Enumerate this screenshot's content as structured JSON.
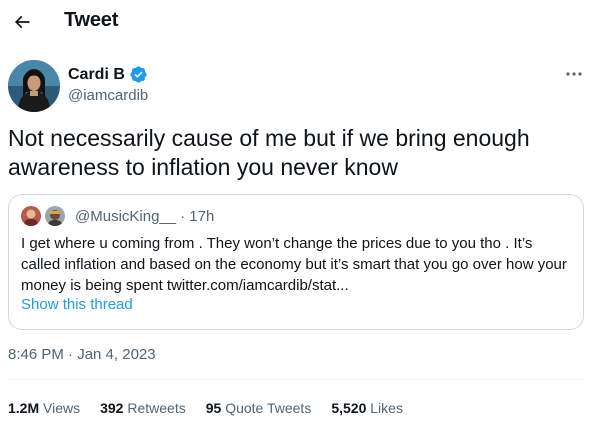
{
  "header": {
    "title": "Tweet",
    "back_icon": "arrow-left-icon"
  },
  "author": {
    "name": "Cardi B",
    "handle": "@iamcardib",
    "verified_icon": "verified-badge-icon",
    "verified_color": "#1d9bf0"
  },
  "tweet": {
    "text": "Not necessarily cause of me but if we bring enough awareness to inflation you never know",
    "timestamp": "8:46 PM · Jan 4, 2023"
  },
  "quote": {
    "handle": "@MusicKing__",
    "time": "· 17h",
    "body": "I get where u coming from . They won’t change the prices due to you tho . It’s called inflation and based on the economy but it’s smart that you go over how your money is being spent twitter.com/iamcardib/stat...",
    "show_thread": "Show this thread"
  },
  "stats": [
    {
      "num": "1.2M",
      "label": "Views"
    },
    {
      "num": "392",
      "label": "Retweets"
    },
    {
      "num": "95",
      "label": "Quote Tweets"
    },
    {
      "num": "5,520",
      "label": "Likes"
    }
  ],
  "colors": {
    "accent": "#1d9bf0",
    "text": "#0f1419",
    "secondary": "#536471",
    "border": "#cfd9de"
  }
}
